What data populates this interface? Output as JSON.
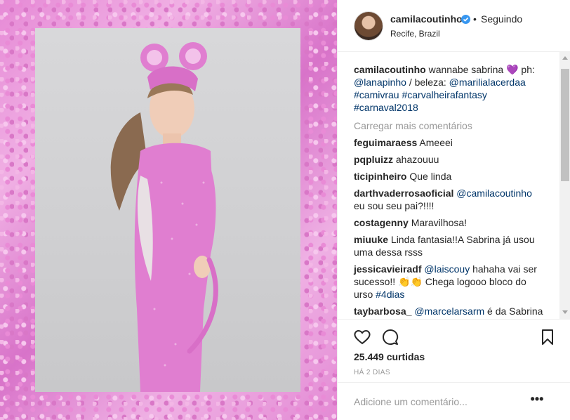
{
  "header": {
    "username": "camilacoutinho",
    "separator": "•",
    "follow_status": "Seguindo",
    "location": "Recife, Brazil"
  },
  "caption": {
    "user": "camilacoutinho",
    "text": " wannabe sabrina 💜 ph: ",
    "mention1": "@lanapinho",
    "mid": " / beleza: ",
    "mention2": "@marilialacerdaa",
    "tags": "#camivrau #carvalheirafantasy #carnaval2018"
  },
  "load_more": "Carregar mais comentários",
  "comments": [
    {
      "user": "feguimaraess",
      "text": "Ameeei"
    },
    {
      "user": "pqpluizz",
      "text": "ahazouuu"
    },
    {
      "user": "ticipinheiro",
      "text": "Que linda"
    },
    {
      "user": "darthvaderrosaoficial",
      "mention": "@camilacoutinho",
      "text": " eu sou seu pai?!!!!"
    },
    {
      "user": "costagenny",
      "text": "Maravilhosa!"
    },
    {
      "user": "miuuke",
      "text": "Linda fantasia!!A Sabrina já usou uma dessa rsss"
    },
    {
      "user": "jessicavieiradf",
      "mention": "@laiscouy",
      "text": " hahaha vai ser sucesso!! 👏👏 Chega logooo bloco do urso ",
      "tag": "#4dias"
    },
    {
      "user": "taybarbosa_",
      "mention": "@marcelarsarm",
      "text": " é da Sabrina"
    }
  ],
  "likes": "25.449 curtidas",
  "time": "HÁ 2 DIAS",
  "add_comment_placeholder": "Adicione um comentário...",
  "more_label": "•••",
  "icons": [
    "heart-icon",
    "comment-icon",
    "bookmark-icon",
    "verified-icon",
    "more-options-icon"
  ],
  "colors": {
    "link": "#003569",
    "verified": "#3897f0",
    "muted": "#999999",
    "text": "#262626"
  }
}
